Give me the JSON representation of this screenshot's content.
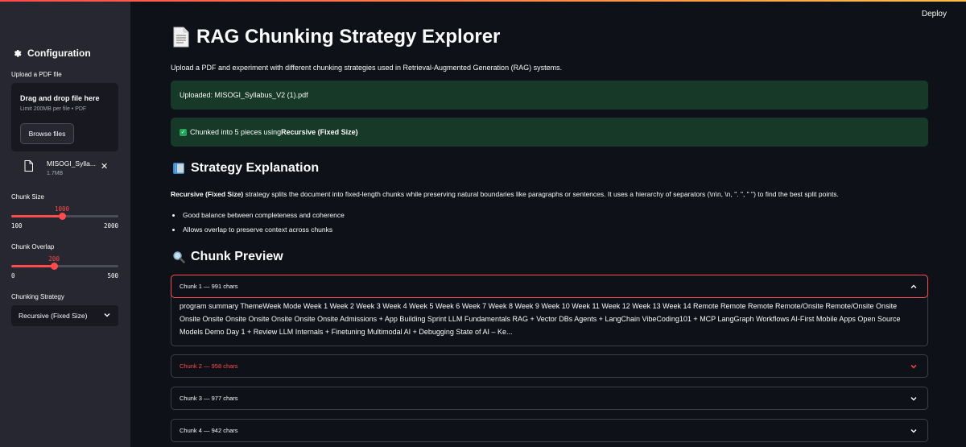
{
  "header": {
    "deploy_label": "Deploy"
  },
  "sidebar": {
    "title": "Configuration",
    "upload_label": "Upload a PDF file",
    "dropzone_title": "Drag and drop file here",
    "dropzone_sub": "Limit 200MB per file • PDF",
    "browse_label": "Browse files",
    "file": {
      "name": "MISOGI_Sylla...",
      "size": "1.7MB"
    },
    "chunk_size": {
      "label": "Chunk Size",
      "value": "1000",
      "min": "100",
      "max": "2000",
      "fraction": 0.4737
    },
    "chunk_overlap": {
      "label": "Chunk Overlap",
      "value": "200",
      "min": "0",
      "max": "500",
      "fraction": 0.4
    },
    "strategy": {
      "label": "Chunking Strategy",
      "value": "Recursive (Fixed Size)"
    }
  },
  "main": {
    "title": "RAG Chunking Strategy Explorer",
    "intro": "Upload a PDF and experiment with different chunking strategies used in Retrieval-Augmented Generation (RAG) systems.",
    "uploaded_alert": "Uploaded: MISOGI_Syllabus_V2 (1).pdf",
    "chunked_alert_prefix": "Chunked into 5 pieces using ",
    "chunked_alert_strategy": "Recursive (Fixed Size)",
    "strategy_heading": "Strategy Explanation",
    "strategy_name": "Recursive (Fixed Size)",
    "strategy_text": " strategy splits the document into fixed-length chunks while preserving natural boundaries like paragraphs or sentences. It uses a hierarchy of separators (\\n\\n, \\n, \". \", \" \") to find the best split points.",
    "bullets": [
      "Good balance between completeness and coherence",
      "Allows overlap to preserve context across chunks"
    ],
    "preview_heading": "Chunk Preview",
    "chunks": [
      {
        "label": "Chunk 1 — 991 chars",
        "text": "program summary ThemeWeek Mode Week 1 Week 2 Week 3 Week 4 Week 5 Week 6 Week 7 Week 8 Week 9 Week 10 Week 11 Week 12 Week 13 Week 14 Remote Remote Remote Remote/Onsite Remote/Onsite Onsite Onsite Onsite Onsite Onsite Onsite Onsite Onsite Admissions + App Building Sprint LLM Fundamentals RAG + Vector DBs Agents + LangChain VibeCoding101 + MCP LangGraph Workflows AI-First Mobile Apps Open Source Models Demo Day 1 + Review LLM Internals + Finetuning Multimodal AI + Debugging State of AI – Ke..."
      },
      {
        "label": "Chunk 2 — 958 chars"
      },
      {
        "label": "Chunk 3 — 977 chars"
      },
      {
        "label": "Chunk 4 — 942 chars"
      }
    ]
  }
}
